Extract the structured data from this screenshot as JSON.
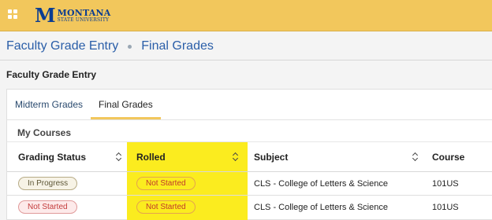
{
  "header": {
    "logo_mark": "M",
    "logo_line1": "MONTANA",
    "logo_line2": "STATE UNIVERSITY"
  },
  "breadcrumb": [
    "Faculty Grade Entry",
    "Final Grades"
  ],
  "section_title": "Faculty Grade Entry",
  "tabs": [
    {
      "label": "Midterm Grades",
      "active": false
    },
    {
      "label": "Final Grades",
      "active": true
    }
  ],
  "courses_label": "My Courses",
  "table": {
    "columns": [
      "Grading Status",
      "Rolled",
      "Subject",
      "Course"
    ],
    "rows": [
      {
        "grading_status": "In Progress",
        "rolled": "Not Started",
        "subject": "CLS - College of Letters & Science",
        "course": "101US"
      },
      {
        "grading_status": "Not Started",
        "rolled": "Not Started",
        "subject": "CLS - College of Letters & Science",
        "course": "101US"
      }
    ]
  },
  "colors": {
    "brand_gold": "#f2c75c",
    "brand_blue": "#0b3d91",
    "highlight": "#fbec1f"
  }
}
